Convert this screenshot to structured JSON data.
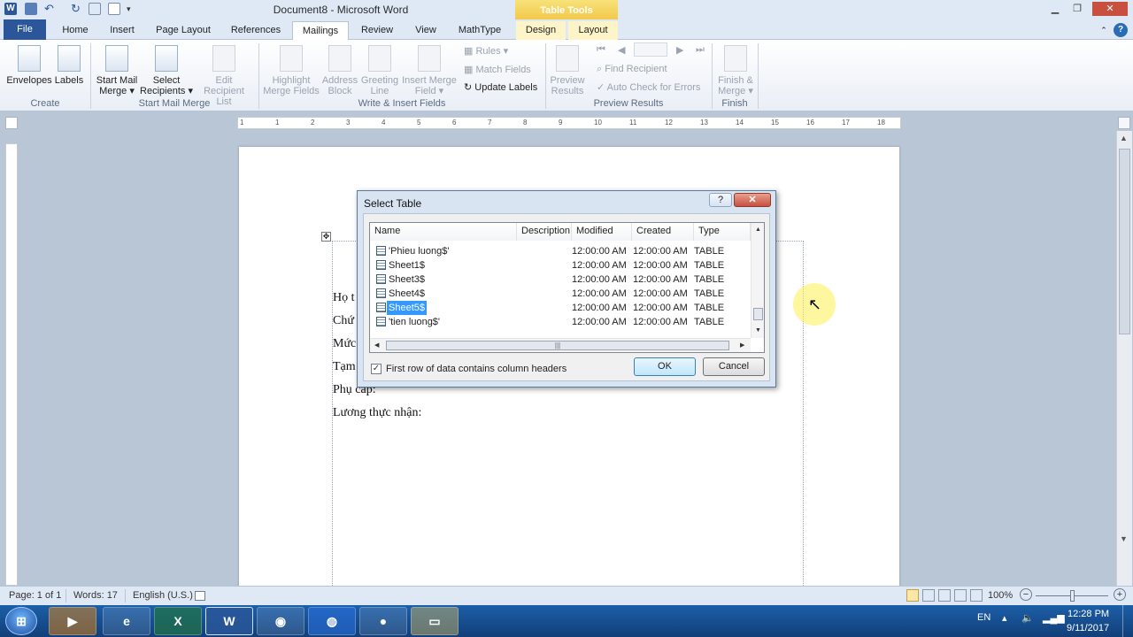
{
  "window": {
    "title": "Document8 - Microsoft Word",
    "table_tools": "Table Tools"
  },
  "tabs": [
    "File",
    "Home",
    "Insert",
    "Page Layout",
    "References",
    "Mailings",
    "Review",
    "View",
    "MathType",
    "Design",
    "Layout"
  ],
  "ribbon": {
    "envelopes": "Envelopes",
    "labels": "Labels",
    "start_mail_merge": [
      "Start Mail",
      "Merge"
    ],
    "select_recipients": [
      "Select",
      "Recipients"
    ],
    "edit_recipient_list": [
      "Edit",
      "Recipient List"
    ],
    "highlight_merge_fields": [
      "Highlight",
      "Merge Fields"
    ],
    "address_block": [
      "Address",
      "Block"
    ],
    "greeting_line": [
      "Greeting",
      "Line"
    ],
    "insert_merge_field": [
      "Insert Merge",
      "Field"
    ],
    "rules": "Rules",
    "match_fields": "Match Fields",
    "update_labels": "Update Labels",
    "preview_results": [
      "Preview",
      "Results"
    ],
    "find_recipient": "Find Recipient",
    "auto_check": "Auto Check for Errors",
    "finish_merge": [
      "Finish &",
      "Merge"
    ],
    "groups": [
      "Create",
      "Start Mail Merge",
      "Write & Insert Fields",
      "Preview Results",
      "Finish"
    ]
  },
  "ruler_ticks": [
    "1",
    "1",
    "2",
    "3",
    "4",
    "5",
    "6",
    "7",
    "8",
    "9",
    "10",
    "11",
    "12",
    "13",
    "14",
    "15",
    "16",
    "17",
    "18"
  ],
  "document": {
    "lines": [
      "Họ t",
      "Chứ",
      "Mức",
      "Tạm",
      "Phụ cấp:",
      "Lương thực nhận:"
    ]
  },
  "dialog": {
    "title": "Select Table",
    "help": "?",
    "close": "✕",
    "columns": [
      "Name",
      "Description",
      "Modified",
      "Created",
      "Type"
    ],
    "rows": [
      {
        "name": "'Phieu luong$'",
        "modified": "12:00:00 AM",
        "created": "12:00:00 AM",
        "type": "TABLE"
      },
      {
        "name": "Sheet1$",
        "modified": "12:00:00 AM",
        "created": "12:00:00 AM",
        "type": "TABLE"
      },
      {
        "name": "Sheet3$",
        "modified": "12:00:00 AM",
        "created": "12:00:00 AM",
        "type": "TABLE"
      },
      {
        "name": "Sheet4$",
        "modified": "12:00:00 AM",
        "created": "12:00:00 AM",
        "type": "TABLE"
      },
      {
        "name": "Sheet5$",
        "modified": "12:00:00 AM",
        "created": "12:00:00 AM",
        "type": "TABLE"
      },
      {
        "name": "'tien luong$'",
        "modified": "12:00:00 AM",
        "created": "12:00:00 AM",
        "type": "TABLE"
      }
    ],
    "selected_row": "Sheet5$",
    "checkbox_label": "First row of data contains column headers",
    "checkbox_checked": true,
    "ok": "OK",
    "cancel": "Cancel"
  },
  "status": {
    "page": "Page: 1 of 1",
    "words": "Words: 17",
    "language": "English (U.S.)",
    "zoom": "100%"
  },
  "taskbar": {
    "lang": "EN",
    "time": "12:28 PM",
    "date": "9/11/2017",
    "apps": [
      "media-player",
      "internet-explorer",
      "excel",
      "word",
      "chrome",
      "app-blue",
      "camera",
      "folder"
    ]
  },
  "colors": {
    "accent": "#2b579a",
    "selection": "#3399ff",
    "table_tools": "#f2c84a"
  }
}
